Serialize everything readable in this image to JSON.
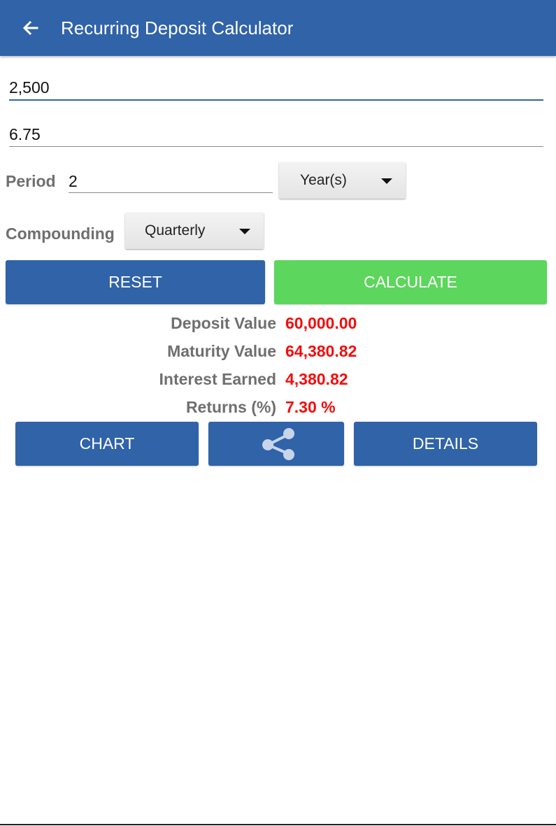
{
  "appbar": {
    "title": "Recurring Deposit Calculator"
  },
  "inputs": {
    "deposit_amount": "2,500",
    "interest_rate": "6.75"
  },
  "period": {
    "label": "Period",
    "value": "2",
    "unit_selected": "Year(s)"
  },
  "compounding": {
    "label": "Compounding",
    "selected": "Quarterly"
  },
  "actions": {
    "reset_label": "RESET",
    "calculate_label": "CALCULATE"
  },
  "results": {
    "deposit_label": "Deposit Value",
    "deposit_value": "60,000.00",
    "maturity_label": "Maturity Value",
    "maturity_value": "64,380.82",
    "interest_label": "Interest Earned",
    "interest_value": "4,380.82",
    "returns_label": "Returns (%)",
    "returns_value": "7.30 %"
  },
  "bottom_actions": {
    "chart_label": "CHART",
    "share_icon": "share-icon",
    "details_label": "DETAILS"
  },
  "colors": {
    "primary": "#3063a8",
    "accent_green": "#5cd65c",
    "result_red": "#f20d0d",
    "label_gray": "#6f6f6f"
  }
}
